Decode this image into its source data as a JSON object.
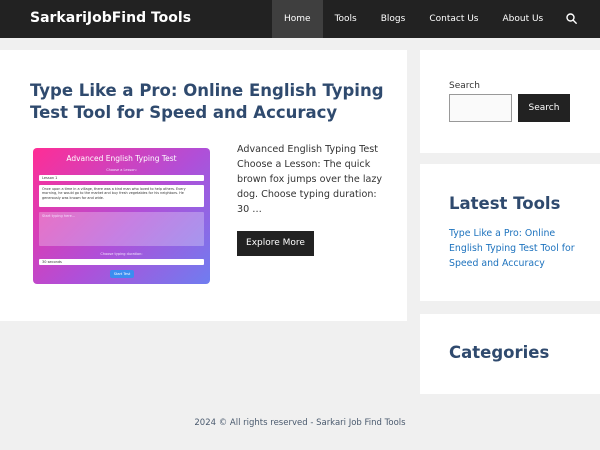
{
  "header": {
    "brand": "SarkariJobFind Tools",
    "nav": [
      "Home",
      "Tools",
      "Blogs",
      "Contact Us",
      "About Us"
    ]
  },
  "article": {
    "title": "Type Like a Pro: Online English Typing Test Tool for Speed and Accuracy",
    "excerpt": "Advanced English Typing Test Choose a Lesson: The quick brown fox jumps over the lazy dog. Choose typing duration: 30 …",
    "button": "Explore More",
    "thumbnail": {
      "title": "Advanced English Typing Test",
      "lesson_label": "Choose a Lesson:",
      "lesson_value": "Lesson 1",
      "sample_text": "Once upon a time in a village, there was a kind man who loved to help others. Every morning, he would go to the market and buy fresh vegetables for his neighbors. He generously was known for and wide.",
      "placeholder": "Start typing here...",
      "duration_label": "Choose typing duration:",
      "duration_value": "30 seconds",
      "start_button": "Start Test"
    }
  },
  "sidebar": {
    "search_label": "Search",
    "search_value": "",
    "search_button": "Search",
    "latest_title": "Latest Tools",
    "latest_link": "Type Like a Pro: Online English Typing Test Tool for Speed and Accuracy",
    "categories_title": "Categories"
  },
  "footer": {
    "text": "2024 © All rights reserved - Sarkari Job Find Tools"
  },
  "colors": {
    "topbar": "#222222",
    "heading": "#2f4a6e",
    "link": "#1e73be",
    "button": "#222222"
  }
}
